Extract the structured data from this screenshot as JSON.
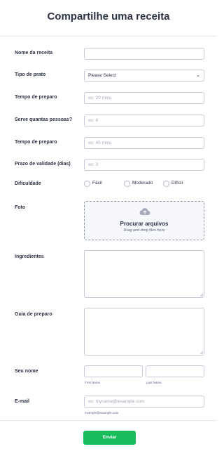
{
  "form": {
    "title": "Compartilhe uma receita",
    "fields": {
      "recipe_name": {
        "label": "Nome da receita",
        "value": ""
      },
      "dish_type": {
        "label": "Tipo de prato",
        "value": "Please Select"
      },
      "prep_time": {
        "label": "Tempo de preparo",
        "placeholder": "ex: 20 mins"
      },
      "servings": {
        "label": "Serve quantas pessoas?",
        "placeholder": "ex: 4"
      },
      "prep_time_2": {
        "label": "Tempo de preparo",
        "placeholder": "ex: 45 mins"
      },
      "shelf_life": {
        "label": "Prazo de validade (dias)",
        "placeholder": "ex: 3"
      },
      "difficulty": {
        "label": "Dificuldade",
        "options": [
          "Fácil",
          "Moderado",
          "Difícil"
        ]
      },
      "photo": {
        "label": "Foto",
        "main": "Procurar arquivos",
        "sub": "Drag and drop files here"
      },
      "ingredients": {
        "label": "Ingredientes"
      },
      "guide": {
        "label": "Guia de preparo"
      },
      "name": {
        "label": "Seu nome",
        "first": "First Name",
        "last": "Last Name"
      },
      "email": {
        "label": "E-mail",
        "placeholder": "ex: myname@example.com",
        "hint": "example@example.com"
      }
    },
    "submit_label": "Enviar"
  },
  "colors": {
    "accent_green": "#18bd5b",
    "text_dark": "#2c3345",
    "border": "#c3cad8"
  }
}
